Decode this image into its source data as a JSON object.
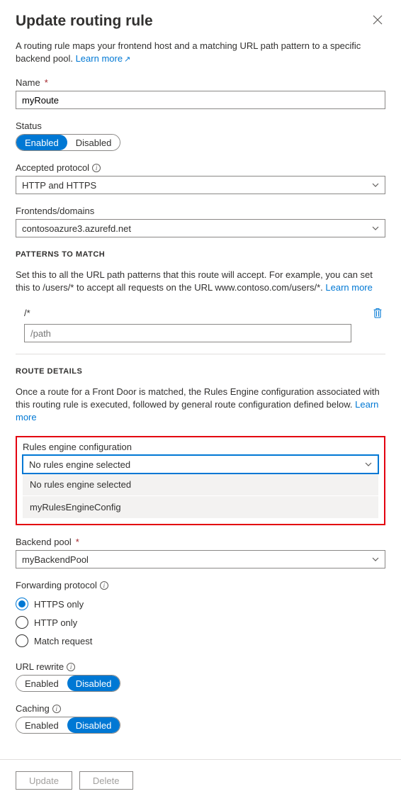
{
  "header": {
    "title": "Update routing rule"
  },
  "intro": {
    "text": "A routing rule maps your frontend host and a matching URL path pattern to a specific backend pool. ",
    "learn_more": "Learn more"
  },
  "name": {
    "label": "Name",
    "value": "myRoute"
  },
  "status": {
    "label": "Status",
    "enabled": "Enabled",
    "disabled": "Disabled"
  },
  "protocol": {
    "label": "Accepted protocol",
    "value": "HTTP and HTTPS"
  },
  "frontends": {
    "label": "Frontends/domains",
    "value": "contosoazure3.azurefd.net"
  },
  "patterns": {
    "heading": "PATTERNS TO MATCH",
    "desc": "Set this to all the URL path patterns that this route will accept. For example, you can set this to /users/* to accept all requests on the URL www.contoso.com/users/*. ",
    "learn_more": "Learn more",
    "existing": "/*",
    "placeholder": "/path"
  },
  "route": {
    "heading": "ROUTE DETAILS",
    "desc": "Once a route for a Front Door is matched, the Rules Engine configuration associated with this routing rule is executed, followed by general route configuration defined below. ",
    "learn_more": "Learn more"
  },
  "rules_engine": {
    "label": "Rules engine configuration",
    "selected": "No rules engine selected",
    "options": [
      "No rules engine selected",
      "myRulesEngineConfig"
    ]
  },
  "backend": {
    "label": "Backend pool",
    "value": "myBackendPool"
  },
  "fwd_protocol": {
    "label": "Forwarding protocol",
    "options": [
      "HTTPS only",
      "HTTP only",
      "Match request"
    ]
  },
  "url_rewrite": {
    "label": "URL rewrite",
    "enabled": "Enabled",
    "disabled": "Disabled"
  },
  "caching": {
    "label": "Caching",
    "enabled": "Enabled",
    "disabled": "Disabled"
  },
  "footer": {
    "update": "Update",
    "delete": "Delete"
  }
}
